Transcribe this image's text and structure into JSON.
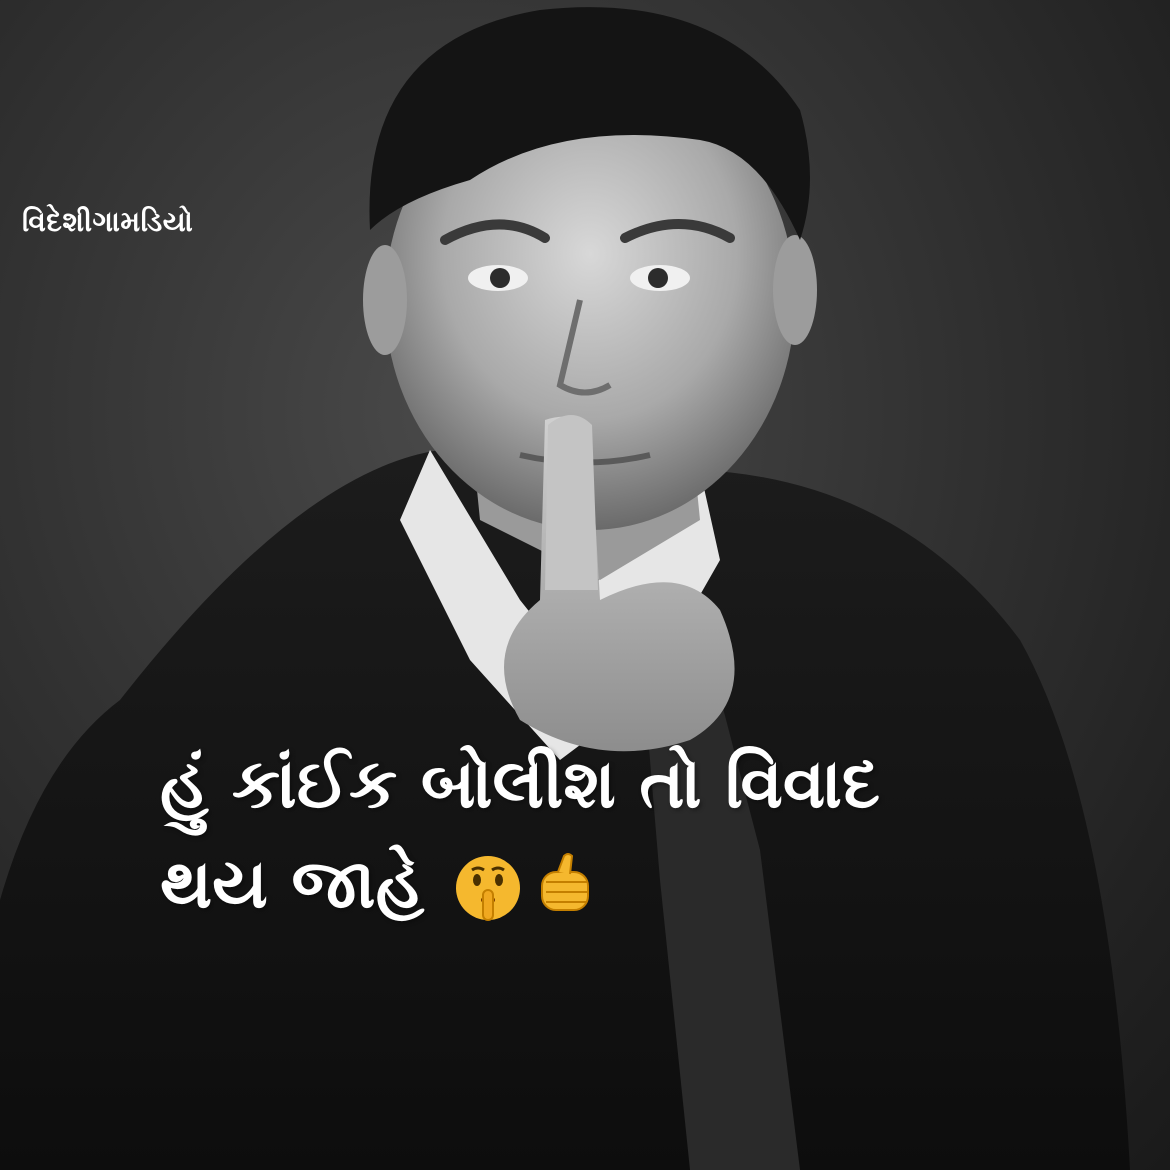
{
  "watermark": "વિદેશીગામડિયો",
  "caption": {
    "line1": "હું કાંઈક બોલીશ તો વિવાદ",
    "line2": "થય જાહે"
  },
  "icons": [
    "shushing-face-icon",
    "pointing-fist-icon"
  ],
  "colors": {
    "text": "#ffffff",
    "background": "#2b2b2b",
    "emoji_yellow": "#f5b82e"
  }
}
